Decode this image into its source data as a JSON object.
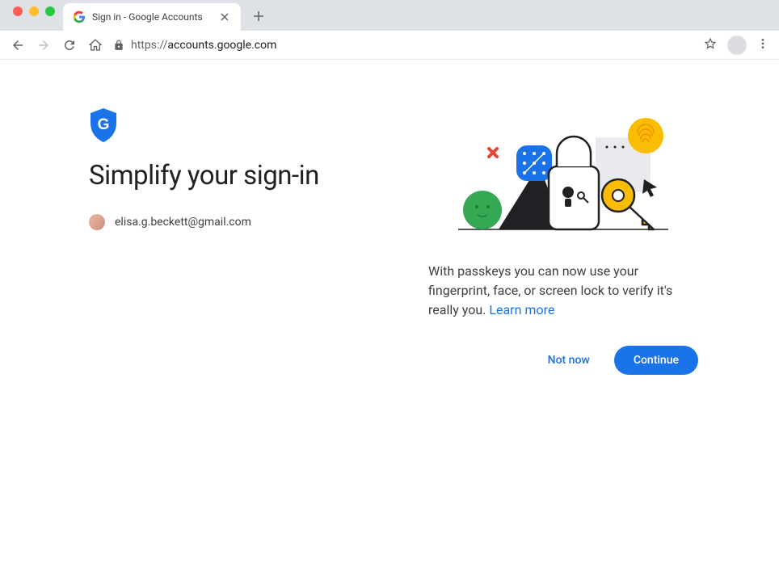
{
  "browser": {
    "tab_title": "Sign in - Google Accounts",
    "url_protocol": "https://",
    "url_domain": "accounts.google.com",
    "url_full": "https://accounts.google.com"
  },
  "page": {
    "title": "Simplify your sign-in",
    "user_email": "elisa.g.beckett@gmail.com",
    "description_text": "With passkeys you can now use your fingerprint, face, or screen lock to verify it's really you. ",
    "learn_more_label": "Learn more",
    "not_now_label": "Not now",
    "continue_label": "Continue"
  },
  "colors": {
    "primary": "#1a73e8",
    "text": "#202124",
    "text_secondary": "#5f6368"
  }
}
